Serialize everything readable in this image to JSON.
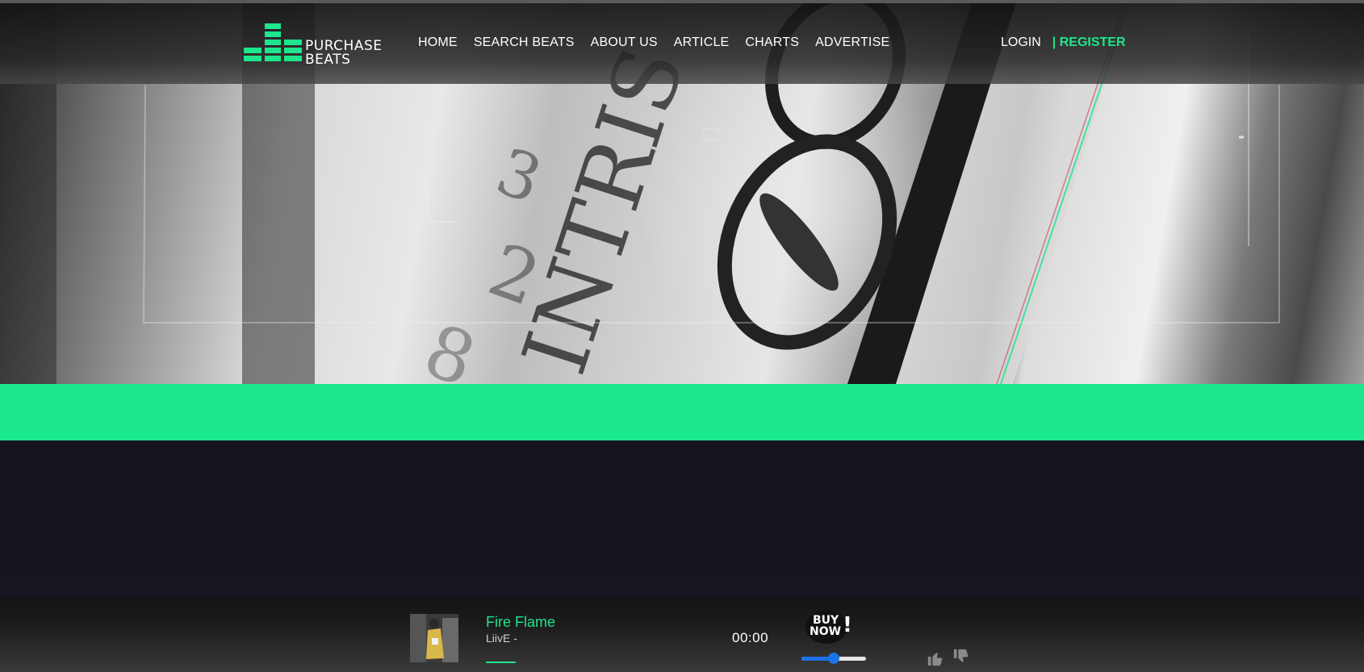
{
  "brand": {
    "line1": "PURCHASE",
    "line2": "BEATS",
    "accent_color": "#1de68c"
  },
  "nav": {
    "items": [
      {
        "label": "HOME"
      },
      {
        "label": "SEARCH BEATS"
      },
      {
        "label": "ABOUT US"
      },
      {
        "label": "ARTICLE"
      },
      {
        "label": "CHARTS"
      },
      {
        "label": "ADVERTISE"
      }
    ]
  },
  "auth": {
    "login_label": "LOGIN",
    "register_label": "| REGISTER"
  },
  "hero": {
    "image_icon": "dollar-bill-closeup-image"
  },
  "player": {
    "track_title": "Fire Flame",
    "artist": "LiivE -",
    "time": "00:00",
    "buy_now_line1": "BUY",
    "buy_now_line2": "NOW",
    "buy_now_mark": "!",
    "volume_level": 0.5,
    "like_icon": "thumbs-up-icon",
    "dislike_icon": "thumbs-down-icon"
  }
}
